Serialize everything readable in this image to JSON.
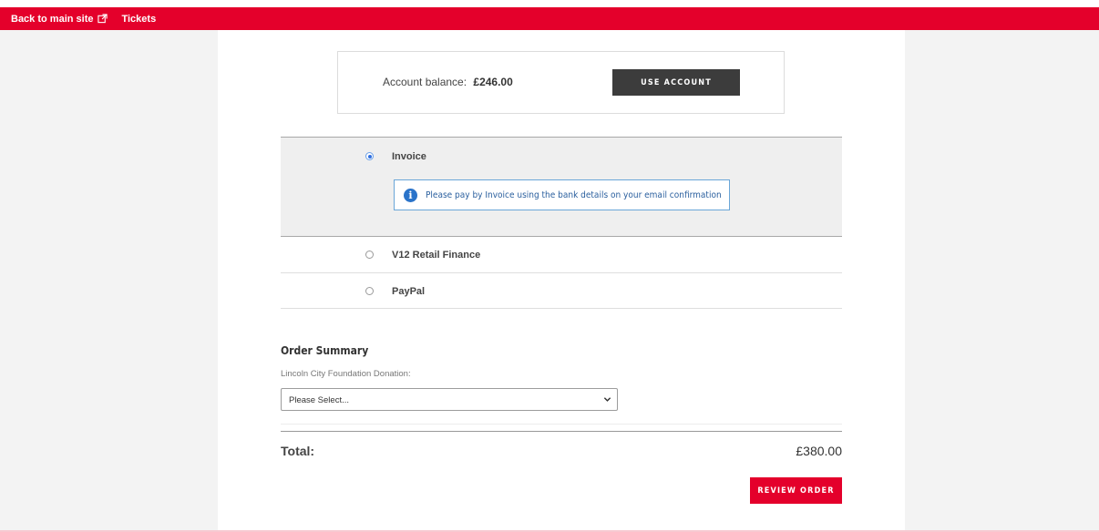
{
  "nav": {
    "back_label": "Back to main site",
    "tickets_label": "Tickets"
  },
  "account": {
    "label": "Account balance:",
    "balance": "£246.00",
    "button_label": "USE ACCOUNT"
  },
  "payment_options": [
    {
      "label": "Invoice",
      "selected": true
    },
    {
      "label": "V12 Retail Finance",
      "selected": false
    },
    {
      "label": "PayPal",
      "selected": false
    }
  ],
  "invoice_info": "Please pay by Invoice using the bank details on your email confirmation",
  "summary": {
    "title": "Order Summary",
    "donation_label": "Lincoln City Foundation Donation:",
    "donation_selected": "Please Select...",
    "total_label": "Total:",
    "total_value": "£380.00",
    "review_label": "REVIEW ORDER"
  },
  "colors": {
    "brand_red": "#e4002b",
    "dark_button": "#3c3c3c",
    "info_blue": "#2a73c9"
  },
  "icons": {
    "external_link": "external-link-icon",
    "info": "info-icon",
    "chevron": "chevron-down-icon"
  }
}
